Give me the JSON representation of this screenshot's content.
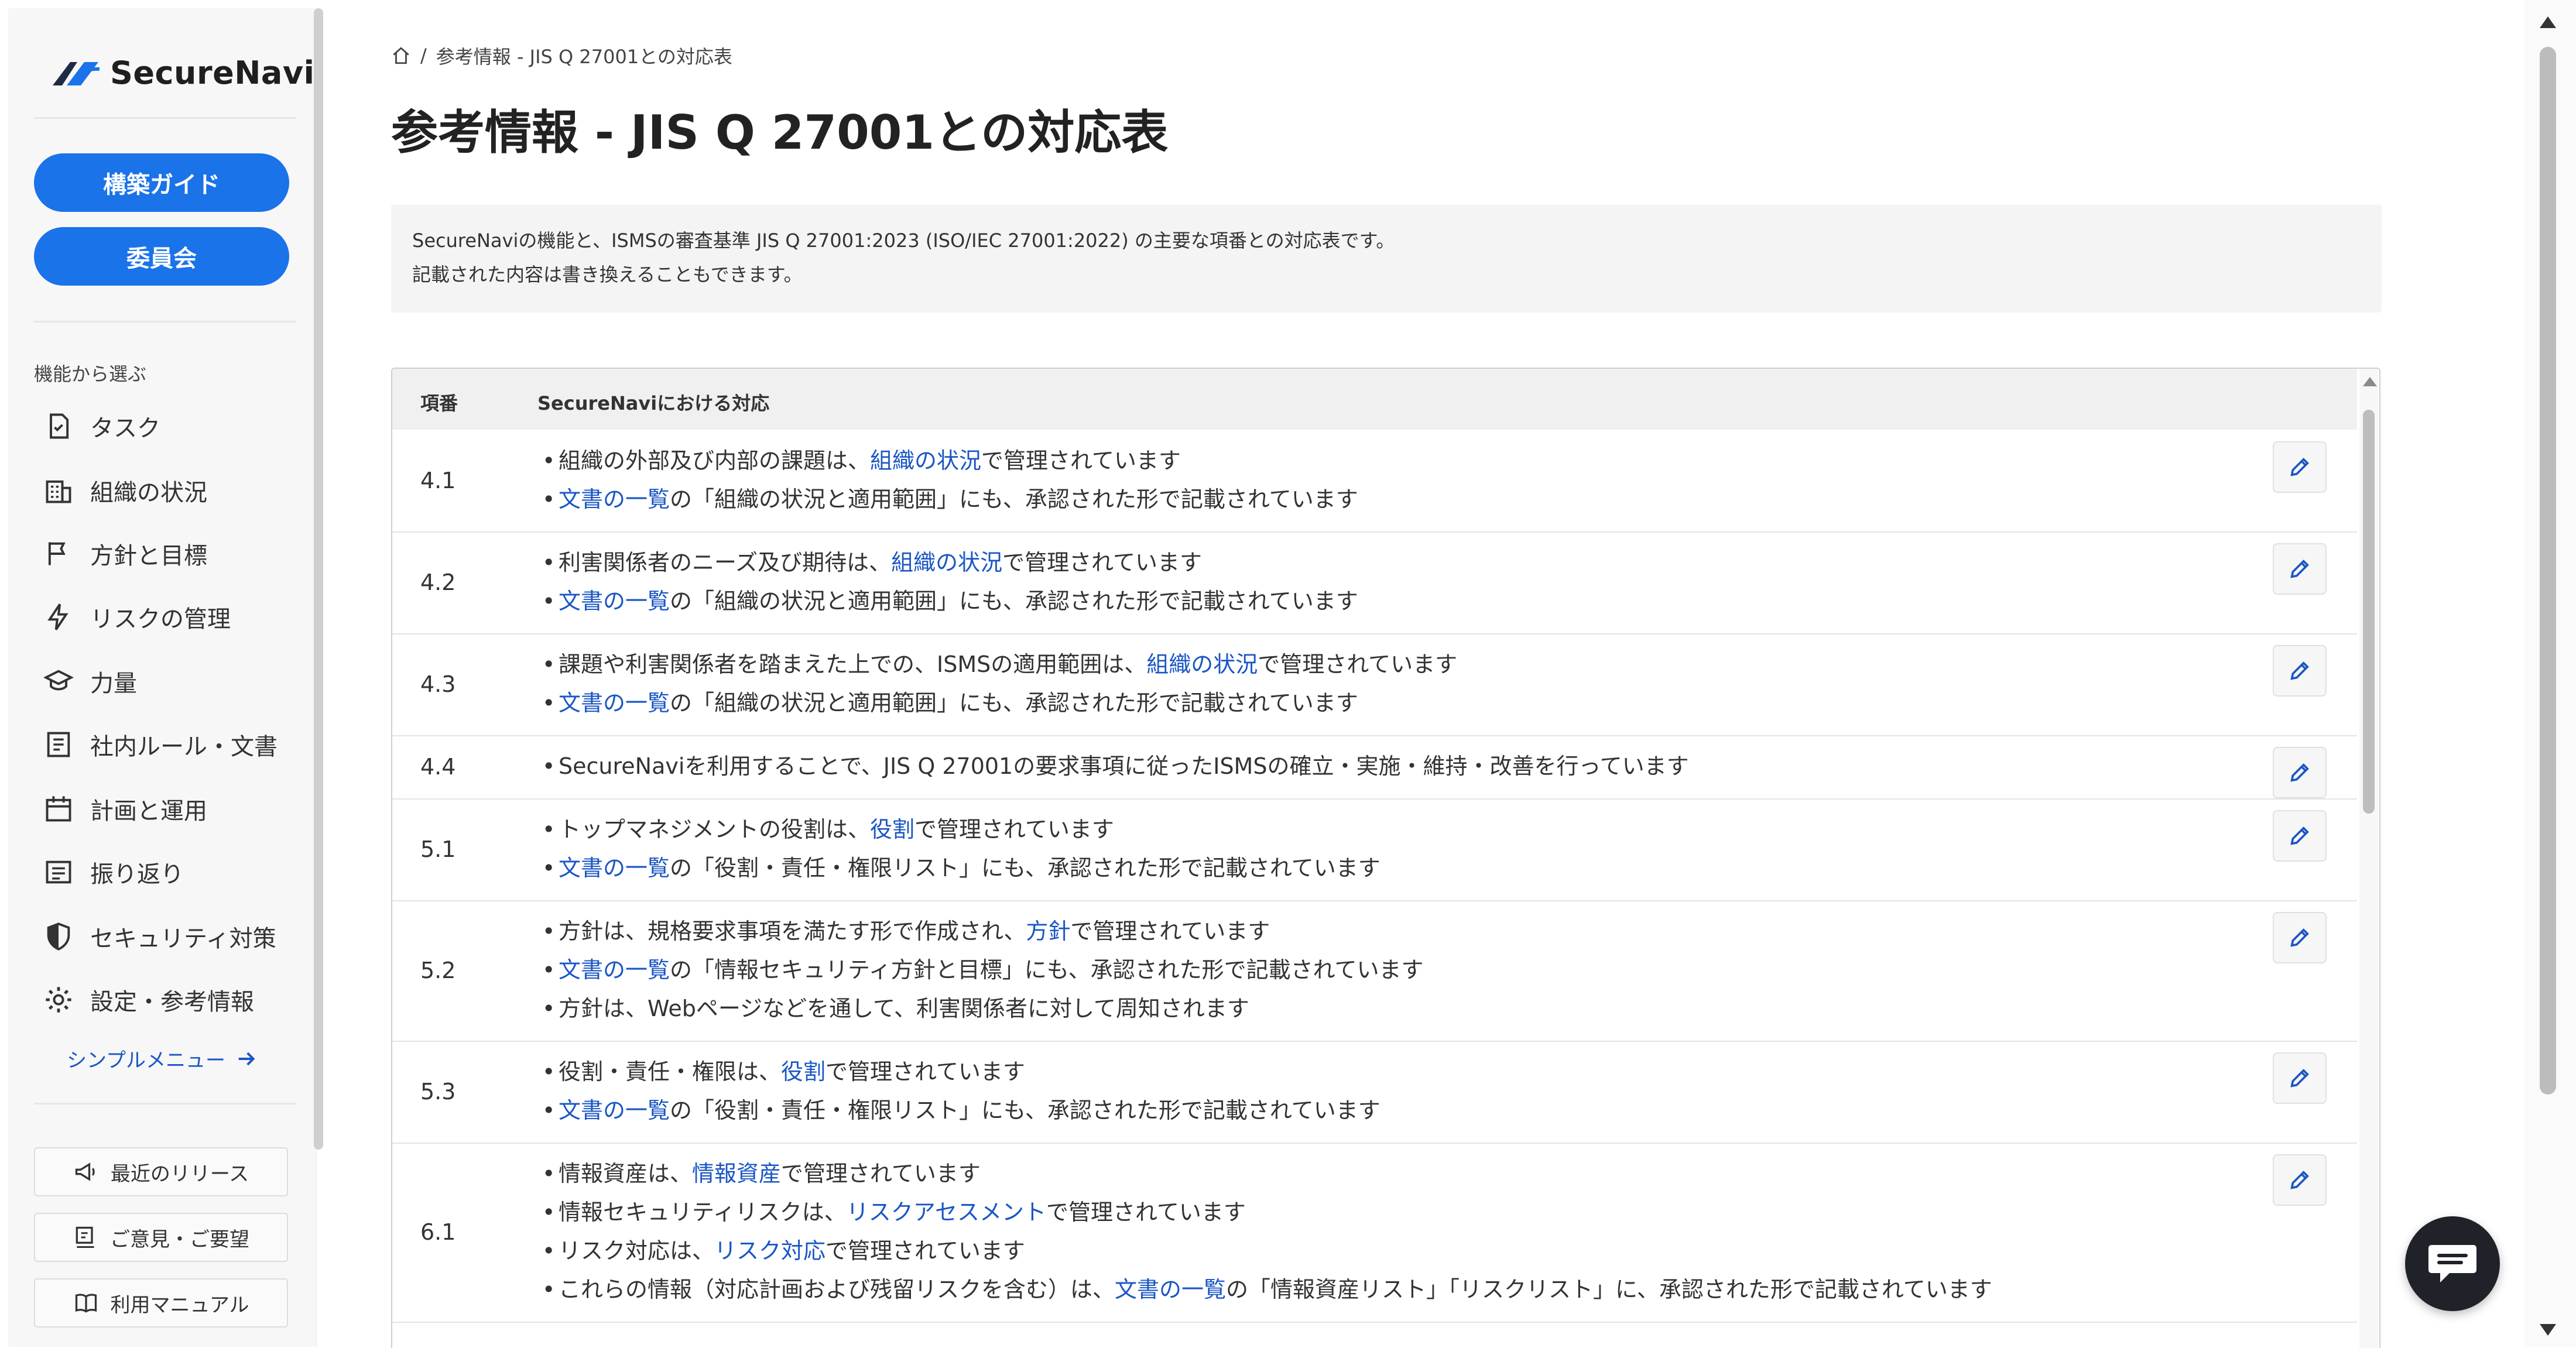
{
  "brand": {
    "name": "SecureNavi",
    "accent": "#1a73e8",
    "link_color": "#1a56c4"
  },
  "sidebar": {
    "primary_buttons": [
      {
        "label": "構築ガイド"
      },
      {
        "label": "委員会"
      }
    ],
    "section_label": "機能から選ぶ",
    "items": [
      {
        "label": "タスク",
        "icon": "task-check-icon"
      },
      {
        "label": "組織の状況",
        "icon": "building-icon"
      },
      {
        "label": "方針と目標",
        "icon": "flag-icon"
      },
      {
        "label": "リスクの管理",
        "icon": "lightning-icon"
      },
      {
        "label": "力量",
        "icon": "graduation-cap-icon"
      },
      {
        "label": "社内ルール・文書",
        "icon": "document-icon"
      },
      {
        "label": "計画と運用",
        "icon": "calendar-icon"
      },
      {
        "label": "振り返り",
        "icon": "review-icon"
      },
      {
        "label": "セキュリティ対策",
        "icon": "shield-icon"
      },
      {
        "label": "設定・参考情報",
        "icon": "gear-icon"
      }
    ],
    "simple_menu_label": "シンプルメニュー",
    "footer_buttons": [
      {
        "label": "最近のリリース",
        "icon": "megaphone-icon"
      },
      {
        "label": "ご意見・ご要望",
        "icon": "feedback-icon"
      },
      {
        "label": "利用マニュアル",
        "icon": "book-icon"
      }
    ]
  },
  "breadcrumb": {
    "current": "参考情報 - JIS Q 27001との対応表",
    "separator": "/"
  },
  "page_title": "参考情報 - JIS Q 27001との対応表",
  "info": {
    "line1": "SecureNaviの機能と、ISMSの審査基準 JIS Q 27001:2023 (ISO/IEC 27001:2022) の主要な項番との対応表です。",
    "line2": "記載された内容は書き換えることもできます。"
  },
  "table": {
    "headers": {
      "number": "項番",
      "mapping": "SecureNaviにおける対応"
    },
    "rows": [
      {
        "number": "4.1",
        "lines": [
          {
            "pre": "組織の外部及び内部の課題は、",
            "link": "組織の状況",
            "post": "で管理されています"
          },
          {
            "pre": "",
            "link": "文書の一覧",
            "post": "の「組織の状況と適用範囲」にも、承認された形で記載されています"
          }
        ]
      },
      {
        "number": "4.2",
        "lines": [
          {
            "pre": "利害関係者のニーズ及び期待は、",
            "link": "組織の状況",
            "post": "で管理されています"
          },
          {
            "pre": "",
            "link": "文書の一覧",
            "post": "の「組織の状況と適用範囲」にも、承認された形で記載されています"
          }
        ]
      },
      {
        "number": "4.3",
        "lines": [
          {
            "pre": "課題や利害関係者を踏まえた上での、ISMSの適用範囲は、",
            "link": "組織の状況",
            "post": "で管理されています"
          },
          {
            "pre": "",
            "link": "文書の一覧",
            "post": "の「組織の状況と適用範囲」にも、承認された形で記載されています"
          }
        ]
      },
      {
        "number": "4.4",
        "lines": [
          {
            "pre": "SecureNaviを利用することで、JIS Q 27001の要求事項に従ったISMSの確立・実施・維持・改善を行っています",
            "link": "",
            "post": ""
          }
        ]
      },
      {
        "number": "5.1",
        "lines": [
          {
            "pre": "トップマネジメントの役割は、",
            "link": "役割",
            "post": "で管理されています"
          },
          {
            "pre": "",
            "link": "文書の一覧",
            "post": "の「役割・責任・権限リスト」にも、承認された形で記載されています"
          }
        ]
      },
      {
        "number": "5.2",
        "lines": [
          {
            "pre": "方針は、規格要求事項を満たす形で作成され、",
            "link": "方針",
            "post": "で管理されています"
          },
          {
            "pre": "",
            "link": "文書の一覧",
            "post": "の「情報セキュリティ方針と目標」にも、承認された形で記載されています"
          },
          {
            "pre": "方針は、Webページなどを通して、利害関係者に対して周知されます",
            "link": "",
            "post": ""
          }
        ]
      },
      {
        "number": "5.3",
        "lines": [
          {
            "pre": "役割・責任・権限は、",
            "link": "役割",
            "post": "で管理されています"
          },
          {
            "pre": "",
            "link": "文書の一覧",
            "post": "の「役割・責任・権限リスト」にも、承認された形で記載されています"
          }
        ]
      },
      {
        "number": "6.1",
        "lines": [
          {
            "pre": "情報資産は、",
            "link": "情報資産",
            "post": "で管理されています"
          },
          {
            "pre": "情報セキュリティリスクは、",
            "link": "リスクアセスメント",
            "post": "で管理されています"
          },
          {
            "pre": "リスク対応は、",
            "link": "リスク対応",
            "post": "で管理されています"
          },
          {
            "pre": "これらの情報（対応計画および残留リスクを含む）は、",
            "link": "文書の一覧",
            "post": "の「情報資産リスト」「リスクリスト」に、承認された形で記載されています"
          }
        ]
      }
    ]
  }
}
